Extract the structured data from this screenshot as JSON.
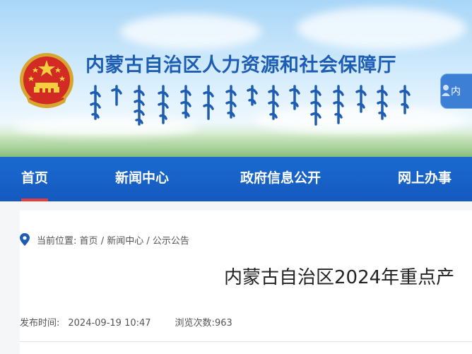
{
  "header": {
    "site_title": "内蒙古自治区人力资源和社会保障厅",
    "right_pill_text": "内",
    "colors": {
      "title_blue": "#1e5db4",
      "nav_blue": "#1a62c8",
      "active_red": "#e33d3d"
    },
    "emblem_icon": "national-emblem-icon"
  },
  "nav": {
    "items": [
      {
        "label": "首页",
        "active": true
      },
      {
        "label": "新闻中心",
        "active": false
      },
      {
        "label": "政府信息公开",
        "active": false
      },
      {
        "label": "网上办事",
        "active": false
      }
    ]
  },
  "breadcrumb": {
    "prefix": "当前位置:",
    "items": [
      "首页",
      "新闻中心",
      "公示公告"
    ],
    "separator": "/"
  },
  "article": {
    "title": "内蒙古自治区2024年重点产",
    "publish_label": "发布时间:",
    "publish_time": "2024-09-19 10:47",
    "views_label": "浏览次数:",
    "views": "963"
  }
}
